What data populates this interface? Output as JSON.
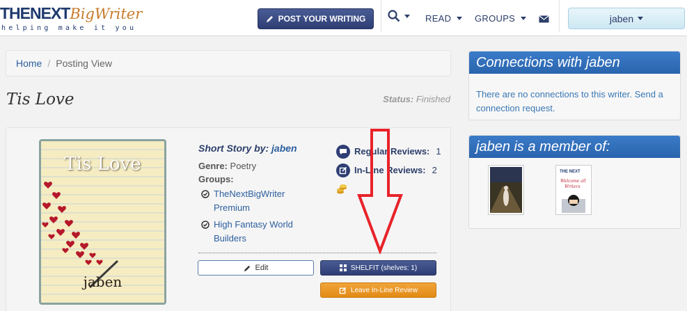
{
  "header": {
    "logo_main": "THENEXT",
    "logo_script": "BigWriter",
    "logo_tagline": "helping make it you",
    "post_button": "POST YOUR WRITING",
    "nav_read": "READ",
    "nav_groups": "GROUPS",
    "user_name": "jaben"
  },
  "breadcrumb": {
    "home": "Home",
    "current": "Posting View"
  },
  "story": {
    "title": "Tis Love",
    "status_label": "Status:",
    "status_value": "Finished",
    "type_label": "Short Story by:",
    "author": "jaben",
    "genre_label": "Genre:",
    "genre_value": "Poetry",
    "groups_label": "Groups:",
    "groups": [
      "TheNextBigWriter Premium",
      "High Fantasy World Builders"
    ],
    "cover_title": "Tis Love",
    "cover_author": "jaben"
  },
  "reviews": {
    "regular_label": "Regular Reviews:",
    "regular_count": "1",
    "inline_label": "In-Line Reviews:",
    "inline_count": "2"
  },
  "actions": {
    "edit": "Edit",
    "shelfit": "SHELFIT (shelves: 1)",
    "leave_inline": "Leave In-Line Review"
  },
  "sidebar": {
    "connections_title": "Connections with jaben",
    "connections_text": "There are no connections to this writer. Send a connection request.",
    "member_title": "jaben is a member of:"
  },
  "colors": {
    "nav_blue": "#2e3e74",
    "panel_head_blue": "#2a64ad",
    "link_blue": "#2c5f9e",
    "orange": "#e28b16",
    "annotation_red": "#e8232a"
  }
}
